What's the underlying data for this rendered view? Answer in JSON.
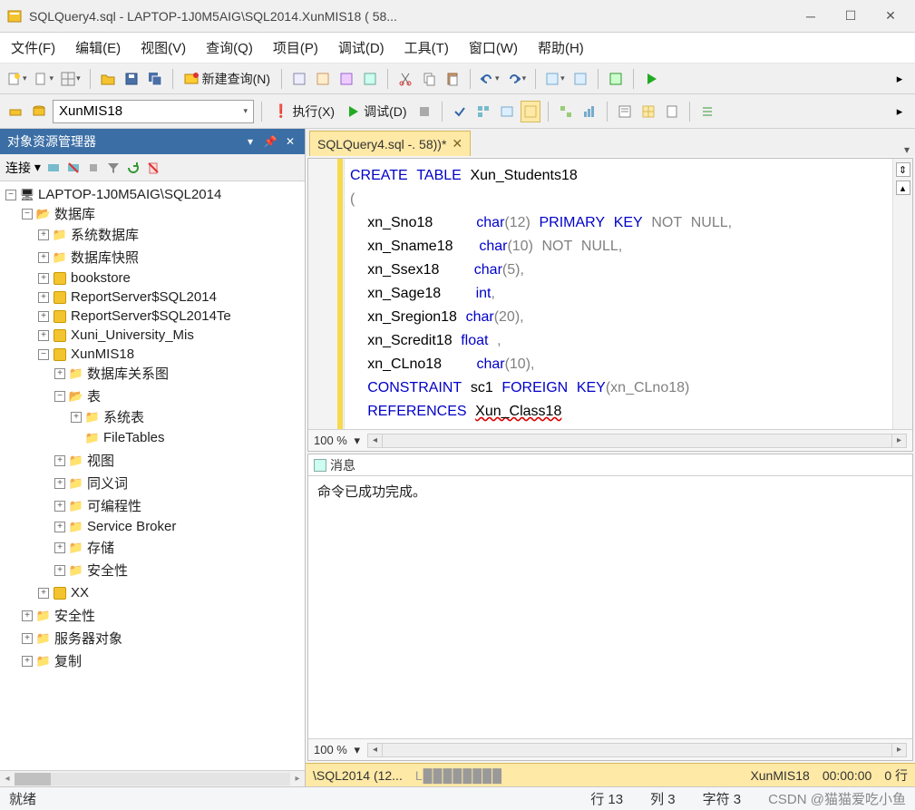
{
  "window": {
    "title": "SQLQuery4.sql - LAPTOP-1J0M5AIG\\SQL2014.XunMIS18 (                       58..."
  },
  "menu": {
    "file": "文件(F)",
    "edit": "编辑(E)",
    "view": "视图(V)",
    "query": "查询(Q)",
    "project": "项目(P)",
    "debug": "调试(D)",
    "tools": "工具(T)",
    "window": "窗口(W)",
    "help": "帮助(H)"
  },
  "toolbar": {
    "new_query": "新建查询(N)"
  },
  "toolbar2": {
    "db_selected": "XunMIS18",
    "execute": "执行(X)",
    "debug": "调试(D)"
  },
  "explorer": {
    "title": "对象资源管理器",
    "connect": "连接",
    "server": "LAPTOP-1J0M5AIG\\SQL2014",
    "databases": "数据库",
    "sysdb": "系统数据库",
    "dbsnap": "数据库快照",
    "db1": "bookstore",
    "db2": "ReportServer$SQL2014",
    "db3": "ReportServer$SQL2014Te",
    "db4": "Xuni_University_Mis",
    "db5": "XunMIS18",
    "diagrams": "数据库关系图",
    "tables": "表",
    "systables": "系统表",
    "filetables": "FileTables",
    "views": "视图",
    "synonyms": "同义词",
    "programmability": "可编程性",
    "servicebroker": "Service Broker",
    "storage": "存储",
    "security_db": "安全性",
    "db6": "XX",
    "security": "安全性",
    "serverobj": "服务器对象",
    "replication": "复制"
  },
  "editor": {
    "tab_label": "SQLQuery4.sql -.               58))*",
    "sql_line1a": "CREATE",
    "sql_line1b": "TABLE",
    "sql_line1c": "Xun_Students18",
    "sql_line2": "(",
    "sql_line3a": "xn_Sno18",
    "sql_line3b": "char",
    "sql_line3c": "(12)",
    "sql_line3d": "PRIMARY",
    "sql_line3e": "KEY",
    "sql_line3f": "NOT",
    "sql_line3g": "NULL",
    "sql_line4a": "xn_Sname18",
    "sql_line4b": "char",
    "sql_line4c": "(10)",
    "sql_line4d": "NOT",
    "sql_line4e": "NULL",
    "sql_line5a": "xn_Ssex18",
    "sql_line5b": "char",
    "sql_line5c": "(5)",
    "sql_line6a": "xn_Sage18",
    "sql_line6b": "int",
    "sql_line7a": "xn_Sregion18",
    "sql_line7b": "char",
    "sql_line7c": "(20)",
    "sql_line8a": "xn_Scredit18",
    "sql_line8b": "float",
    "sql_line9a": "xn_CLno18",
    "sql_line9b": "char",
    "sql_line9c": "(10)",
    "sql_line10a": "CONSTRAINT",
    "sql_line10b": "sc1",
    "sql_line10c": "FOREIGN",
    "sql_line10d": "KEY",
    "sql_line10e": "(xn_CLno18)",
    "sql_line11a": "REFERENCES",
    "sql_line11b": "Xun_Class18",
    "zoom": "100 %",
    "messages_tab": "消息",
    "messages_body": "命令已成功完成。",
    "zoom2": "100 %"
  },
  "editor_status": {
    "server": "\\SQL2014 (12...",
    "login_pre": "L",
    "db": "XunMIS18",
    "time": "00:00:00",
    "rows": "0 行"
  },
  "status": {
    "ready": "就绪",
    "line": "行 13",
    "col": "列 3",
    "char": "字符 3",
    "watermark": "CSDN @猫猫爱吃小鱼"
  }
}
